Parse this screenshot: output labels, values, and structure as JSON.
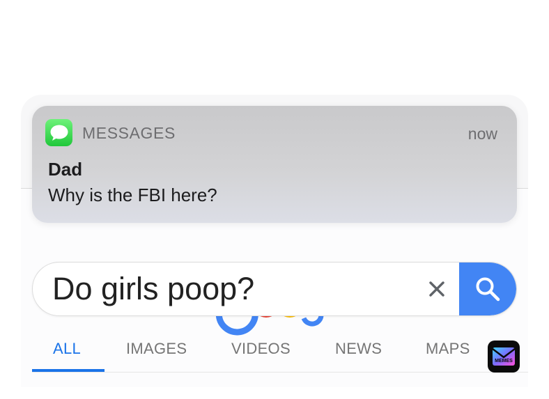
{
  "notification": {
    "app_name": "MESSAGES",
    "time": "now",
    "sender": "Dad",
    "message": "Why is the FBI here?",
    "app_icon": "messages-bubble-icon"
  },
  "search": {
    "query": "Do girls poop?",
    "clear_icon": "close-icon",
    "submit_icon": "search-icon"
  },
  "tabs": [
    {
      "label": "ALL",
      "active": true
    },
    {
      "label": "IMAGES",
      "active": false
    },
    {
      "label": "VIDEOS",
      "active": false
    },
    {
      "label": "NEWS",
      "active": false
    },
    {
      "label": "MAPS",
      "active": false
    }
  ],
  "watermark": {
    "text": "MEMES"
  },
  "colors": {
    "accent_blue": "#4285f4",
    "tab_active": "#1a73e8",
    "messages_green": "#20c73a"
  }
}
